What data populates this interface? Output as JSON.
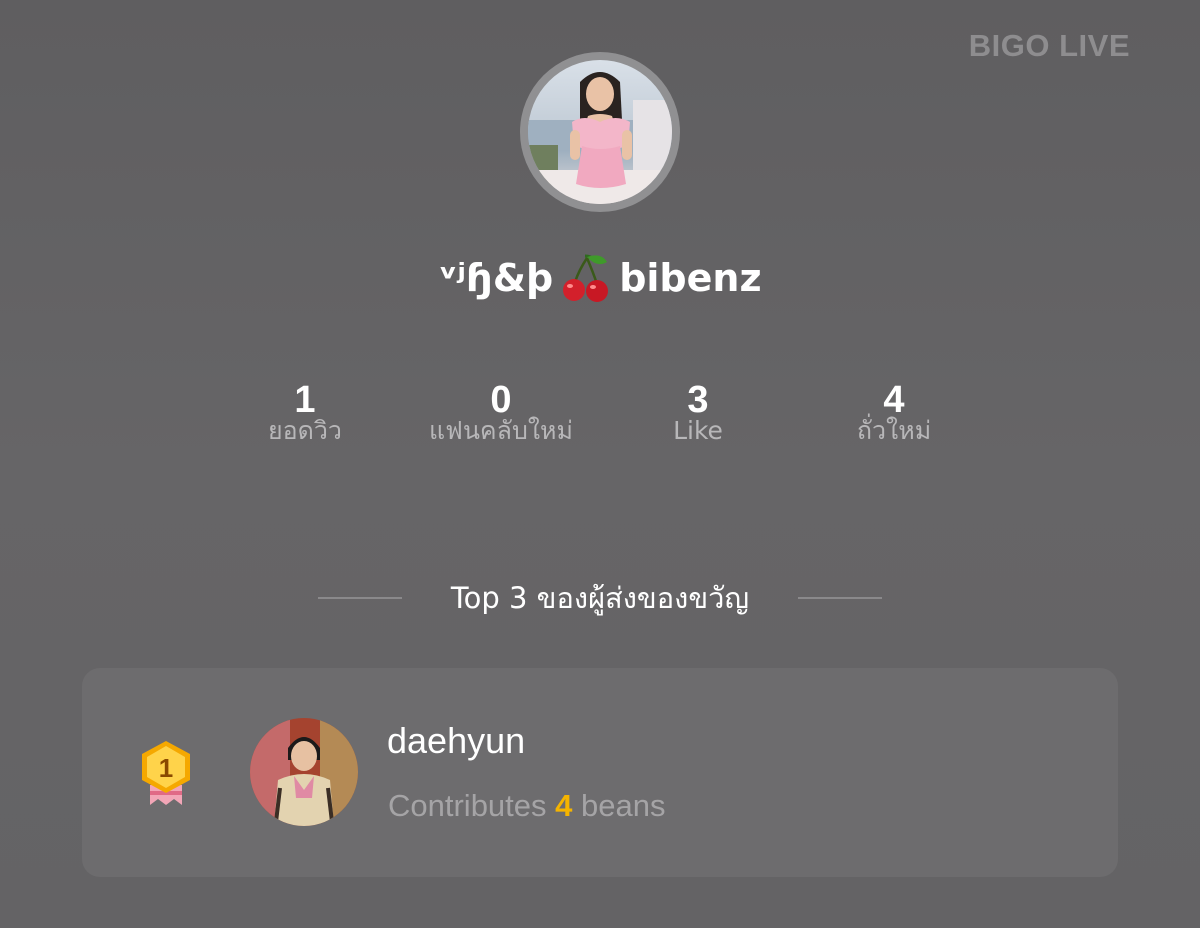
{
  "brand": {
    "logo_text": "BIGO LIVE"
  },
  "profile": {
    "avatar_alt": "profile-photo",
    "name_prefix": "ᵛʲɧ&ϸ",
    "name_emoji": "cherry-icon",
    "name_suffix": "bibenz"
  },
  "stats": [
    {
      "value": "1",
      "label": "ยอดวิว"
    },
    {
      "value": "0",
      "label": "แฟนคลับใหม่"
    },
    {
      "value": "3",
      "label": "Like"
    },
    {
      "value": "4",
      "label": "ถั่วใหม่"
    }
  ],
  "top_gifters": {
    "title": "Top 3 ของผู้ส่งของขวัญ",
    "entries": [
      {
        "rank": "1",
        "name": "daehyun",
        "contrib_prefix": "Contributes",
        "contrib_amount": "4",
        "contrib_suffix": "beans"
      }
    ]
  },
  "colors": {
    "background": "#636264",
    "card": "#6d6c6e",
    "accent_gold": "#f5b400",
    "muted_text": "#a5a4a6"
  }
}
